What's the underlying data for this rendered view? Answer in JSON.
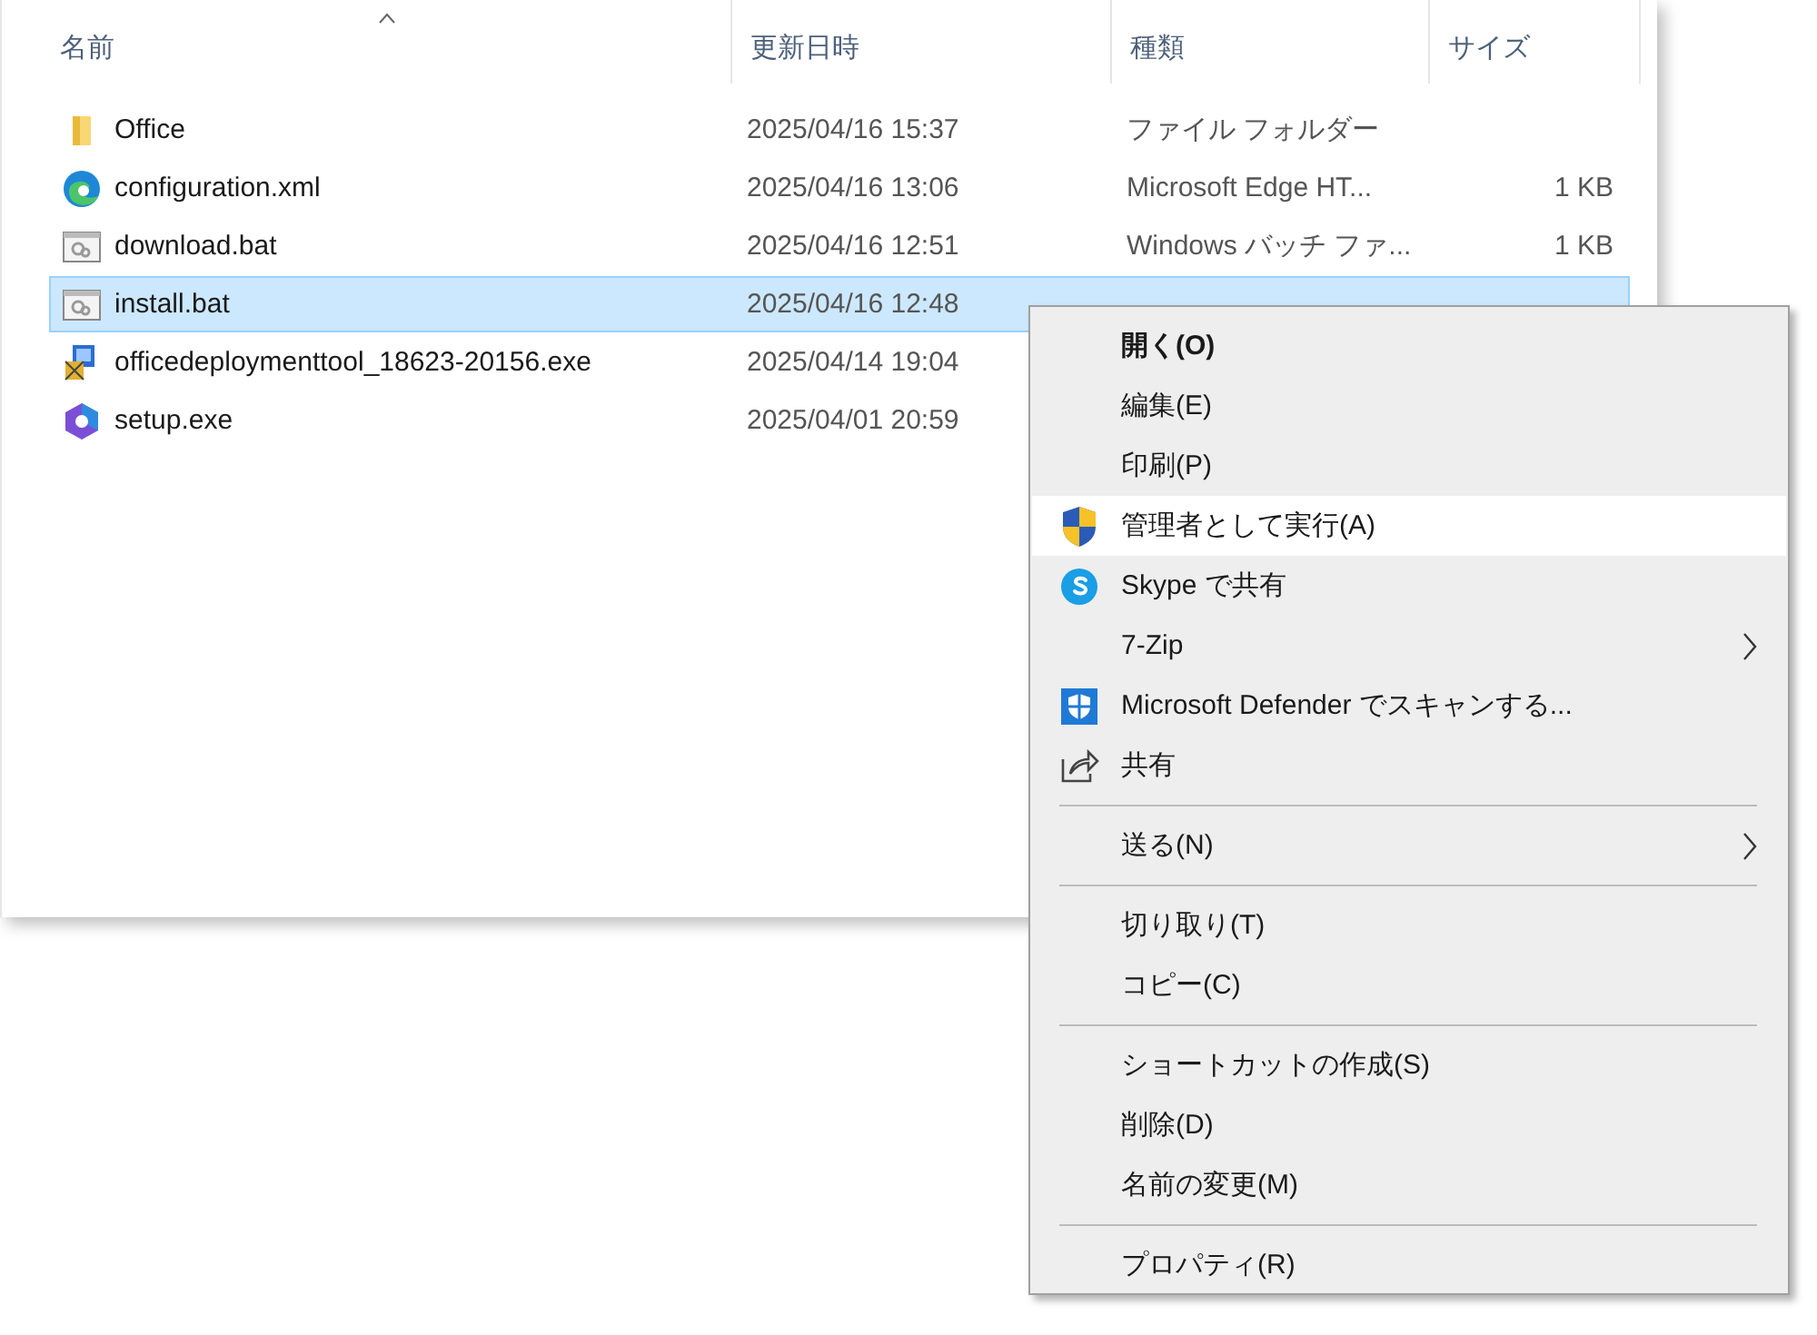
{
  "columns": [
    {
      "label": "名前",
      "sorted": true
    },
    {
      "label": "更新日時",
      "sorted": false
    },
    {
      "label": "種類",
      "sorted": false
    },
    {
      "label": "サイズ",
      "sorted": false
    }
  ],
  "files": [
    {
      "name": "Office",
      "modified": "2025/04/16 15:37",
      "type": "ファイル フォルダー",
      "selected": false
    },
    {
      "name": "configuration.xml",
      "modified": "2025/04/16 13:06",
      "type": "Microsoft Edge HT...",
      "size": "1 KB",
      "selected": false
    },
    {
      "name": "download.bat",
      "modified": "2025/04/16 12:51",
      "type": "Windows バッチ ファ...",
      "size": "1 KB",
      "selected": false
    },
    {
      "name": "install.bat",
      "modified": "2025/04/16 12:48",
      "selected": true
    },
    {
      "name": "officedeploymenttool_18623-20156.exe",
      "modified": "2025/04/14 19:04",
      "selected": false
    },
    {
      "name": "setup.exe",
      "modified": "2025/04/01 20:59",
      "selected": false
    }
  ],
  "context_menu": [
    {
      "kind": "item",
      "label": "開く(O)",
      "bold": true,
      "highlighted": false,
      "submenu": false
    },
    {
      "kind": "item",
      "label": "編集(E)",
      "bold": false,
      "highlighted": false,
      "submenu": false
    },
    {
      "kind": "item",
      "label": "印刷(P)",
      "bold": false,
      "highlighted": false,
      "submenu": false
    },
    {
      "kind": "item",
      "label": "管理者として実行(A)",
      "bold": false,
      "highlighted": true,
      "submenu": false
    },
    {
      "kind": "item",
      "label": "Skype で共有",
      "bold": false,
      "highlighted": false,
      "submenu": false
    },
    {
      "kind": "item",
      "label": "7-Zip",
      "bold": false,
      "highlighted": false,
      "submenu": true
    },
    {
      "kind": "item",
      "label": "Microsoft Defender でスキャンする...",
      "bold": false,
      "highlighted": false,
      "submenu": false
    },
    {
      "kind": "item",
      "label": "共有",
      "bold": false,
      "highlighted": false,
      "submenu": false
    },
    {
      "kind": "separator"
    },
    {
      "kind": "item",
      "label": "送る(N)",
      "bold": false,
      "highlighted": false,
      "submenu": true
    },
    {
      "kind": "separator"
    },
    {
      "kind": "item",
      "label": "切り取り(T)",
      "bold": false,
      "highlighted": false,
      "submenu": false
    },
    {
      "kind": "item",
      "label": "コピー(C)",
      "bold": false,
      "highlighted": false,
      "submenu": false
    },
    {
      "kind": "separator"
    },
    {
      "kind": "item",
      "label": "ショートカットの作成(S)",
      "bold": false,
      "highlighted": false,
      "submenu": false
    },
    {
      "kind": "item",
      "label": "削除(D)",
      "bold": false,
      "highlighted": false,
      "submenu": false
    },
    {
      "kind": "item",
      "label": "名前の変更(M)",
      "bold": false,
      "highlighted": false,
      "submenu": false
    },
    {
      "kind": "separator"
    },
    {
      "kind": "item",
      "label": "プロパティ(R)",
      "bold": false,
      "highlighted": false,
      "submenu": false
    }
  ]
}
